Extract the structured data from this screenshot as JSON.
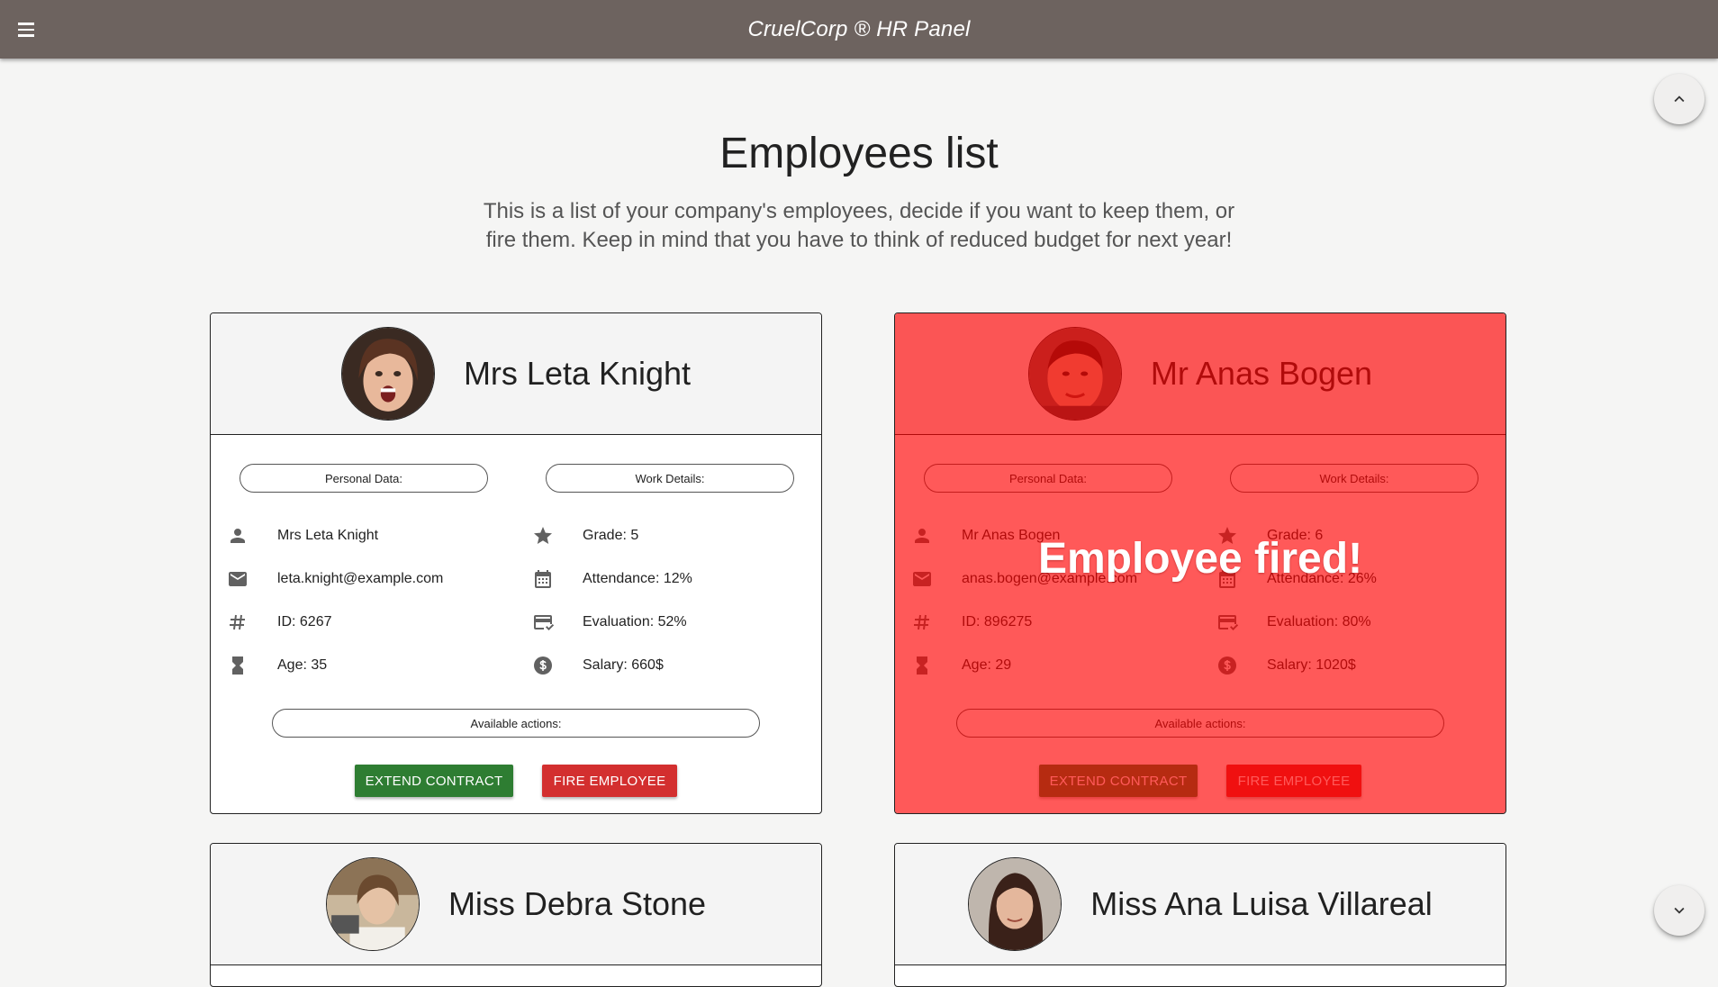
{
  "app": {
    "title": "CruelCorp ® HR Panel"
  },
  "header": {
    "title": "Employees list",
    "intro": "This is a list of your company's employees, decide if you want to keep them, or fire them. Keep in mind that you have to think of reduced budget for next year!"
  },
  "labels": {
    "personal": "Personal Data:",
    "work": "Work Details:",
    "actions": "Available actions:",
    "extend": "Extend contract",
    "fire": "Fire employee",
    "fired_overlay": "Employee fired!"
  },
  "colors": {
    "topbar": "#6d635f",
    "extend": "#2e7d32",
    "fire": "#d32f2f",
    "fired_overlay": "#ff0000"
  },
  "employees": [
    {
      "name": "Mrs Leta Knight",
      "email": "leta.knight@example.com",
      "id": "ID: 6267",
      "age": "Age: 35",
      "grade": "Grade: 5",
      "attendance": "Attendance: 12%",
      "evaluation": "Evaluation: 52%",
      "salary": "Salary: 660$",
      "fired": false
    },
    {
      "name": "Mr Anas Bogen",
      "email": "anas.bogen@example.com",
      "id": "ID: 896275",
      "age": "Age: 29",
      "grade": "Grade: 6",
      "attendance": "Attendance: 26%",
      "evaluation": "Evaluation: 80%",
      "salary": "Salary: 1020$",
      "fired": true
    },
    {
      "name": "Miss Debra Stone"
    },
    {
      "name": "Miss Ana Luisa Villareal"
    }
  ],
  "icons": {
    "menu": "menu-icon",
    "scroll_up": "chevron-up-icon",
    "scroll_down": "chevron-down-icon",
    "person": "person-icon",
    "email": "email-icon",
    "id": "hash-icon",
    "age": "hourglass-icon",
    "grade": "star-icon",
    "attendance": "calendar-icon",
    "evaluation": "card-check-icon",
    "salary": "dollar-icon"
  }
}
